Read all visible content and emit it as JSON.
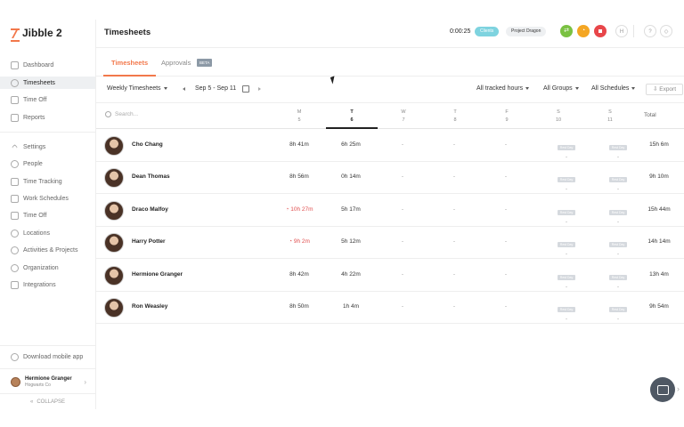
{
  "app": {
    "logo_text": "Jibble 2"
  },
  "sidebar": {
    "items": [
      {
        "label": "Dashboard",
        "icon": "dashboard-icon"
      },
      {
        "label": "Timesheets",
        "icon": "clock-icon",
        "active": true
      },
      {
        "label": "Time Off",
        "icon": "calendar-icon"
      },
      {
        "label": "Reports",
        "icon": "reports-icon"
      }
    ],
    "settings_items": [
      {
        "label": "Settings",
        "icon": "settings-chevron-icon"
      },
      {
        "label": "People",
        "icon": "people-icon"
      },
      {
        "label": "Time Tracking",
        "icon": "time-tracking-icon"
      },
      {
        "label": "Work Schedules",
        "icon": "schedule-icon"
      },
      {
        "label": "Time Off",
        "icon": "time-off-icon"
      },
      {
        "label": "Locations",
        "icon": "location-icon"
      },
      {
        "label": "Activities & Projects",
        "icon": "activities-icon"
      },
      {
        "label": "Organization",
        "icon": "organization-icon"
      },
      {
        "label": "Integrations",
        "icon": "integrations-icon"
      }
    ],
    "download_label": "Download mobile app",
    "user": {
      "name": "Hermione Granger",
      "org": "Hogwarts Co"
    },
    "collapse_label": "COLLAPSE"
  },
  "topbar": {
    "title": "Timesheets",
    "timer": "0:00:25",
    "client_pill": "Clients",
    "project_pill": "Project Dragon",
    "user_initial": "H"
  },
  "tabs": {
    "timesheets": "Timesheets",
    "approvals": "Approvals",
    "beta": "BETA"
  },
  "controls": {
    "view": "Weekly Timesheets",
    "range": "Sep 5 - Sep 11",
    "tracked": "All tracked hours",
    "groups": "All Groups",
    "schedules": "All Schedules",
    "export": "Export"
  },
  "table": {
    "search_placeholder": "Search...",
    "days": [
      {
        "letter": "M",
        "num": "5"
      },
      {
        "letter": "T",
        "num": "6",
        "current": true
      },
      {
        "letter": "W",
        "num": "7"
      },
      {
        "letter": "T",
        "num": "8"
      },
      {
        "letter": "F",
        "num": "9"
      },
      {
        "letter": "S",
        "num": "10"
      },
      {
        "letter": "S",
        "num": "11"
      }
    ],
    "total_label": "Total",
    "rest_label": "Rest Day",
    "dash": "-",
    "rows": [
      {
        "name": "Cho Chang",
        "mon": "8h 41m",
        "tue": "6h 25m",
        "total": "15h 6m",
        "alert": false
      },
      {
        "name": "Dean Thomas",
        "mon": "8h 56m",
        "tue": "0h 14m",
        "total": "9h 10m",
        "alert": false
      },
      {
        "name": "Draco Malfoy",
        "mon": "10h 27m",
        "tue": "5h 17m",
        "total": "15h 44m",
        "alert": true
      },
      {
        "name": "Harry Potter",
        "mon": "9h 2m",
        "tue": "5h 12m",
        "total": "14h 14m",
        "alert": true
      },
      {
        "name": "Hermione Granger",
        "mon": "8h 42m",
        "tue": "4h 22m",
        "total": "13h 4m",
        "alert": false
      },
      {
        "name": "Ron Weasley",
        "mon": "8h 50m",
        "tue": "1h 4m",
        "total": "9h 54m",
        "alert": false
      }
    ]
  },
  "colors": {
    "accent": "#f2784b",
    "alert": "#e04e4e",
    "clients": "#7ed3df"
  }
}
